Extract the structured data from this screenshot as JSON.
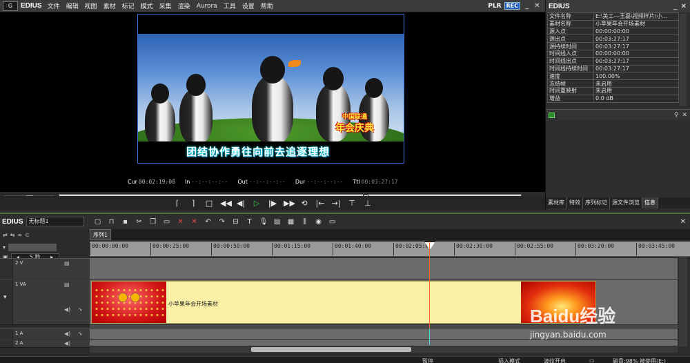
{
  "app_name": "EDIUS",
  "menu": [
    "文件",
    "编辑",
    "视图",
    "素材",
    "标记",
    "模式",
    "采集",
    "渲染",
    "Aurora",
    "工具",
    "设置",
    "帮助"
  ],
  "player_mode": {
    "plr": "PLR",
    "rec": "REC"
  },
  "preview": {
    "subtitle": "团结协作勇往向前去追逐理想",
    "overlay_line1": "中国联通",
    "overlay_line2": "年会庆典"
  },
  "timecodes": [
    {
      "label": "Cur",
      "value": "00:02:19:08"
    },
    {
      "label": "In",
      "value": "--:--:--:--"
    },
    {
      "label": "Out",
      "value": "--:--:--:--"
    },
    {
      "label": "Dur",
      "value": "--:--:--:--"
    },
    {
      "label": "Ttl",
      "value": "00:03:27:17"
    }
  ],
  "scrub_position": 0.665,
  "info_panel": {
    "title": "EDIUS",
    "rows": [
      {
        "key": "文件名称",
        "value": "E:\\美工---王磊\\视频样片\\小..."
      },
      {
        "key": "素材名称",
        "value": "小苹果年会开场素材"
      },
      {
        "key": "源入点",
        "value": "00:00:00:00"
      },
      {
        "key": "源出点",
        "value": "00:03:27:17"
      },
      {
        "key": "源持续时间",
        "value": "00:03:27:17"
      },
      {
        "key": "时间线入点",
        "value": "00:00:00:00"
      },
      {
        "key": "时间线出点",
        "value": "00:03:27:17"
      },
      {
        "key": "时间线持续时间",
        "value": "00:03:27:17"
      },
      {
        "key": "速度",
        "value": "100.00%"
      },
      {
        "key": "冻结帧",
        "value": "未启用"
      },
      {
        "key": "时间重映射",
        "value": "未启用"
      },
      {
        "key": "增益",
        "value": "0.0 dB"
      }
    ],
    "tabs": [
      "素材库",
      "特效",
      "序列标记",
      "源文件浏览",
      "信息"
    ],
    "active_tab": "信息"
  },
  "timeline": {
    "app_name": "EDIUS",
    "project_name": "无标题1",
    "scale_label": "5 秒",
    "sequence_tab": "序列1",
    "ruler_ticks": [
      "00:00:00:00",
      "00:00:25:00",
      "00:00:50:00",
      "00:01:15:00",
      "00:01:40:00",
      "00:02:05:00",
      "00:02:30:00",
      "00:02:55:00",
      "00:03:20:00",
      "00:03:45:00"
    ],
    "tracks": [
      {
        "name": "2 V"
      },
      {
        "name": "1 VA"
      },
      {
        "name": "1 A"
      },
      {
        "name": "2 A"
      }
    ],
    "clip_label": "小苹果年会开场素材"
  },
  "status_bar": {
    "state": "暂停",
    "insert_mode": "插入模式",
    "ripple": "波纹开启",
    "disk": "磁盘:98% 被使用(E:)"
  },
  "watermark": {
    "brand": "Baidu经验",
    "url": "jingyan.baidu.com"
  },
  "colors": {
    "accent_green": "#39d13c",
    "clip_fill": "#fbf1a6",
    "playhead": "#ff6b2d",
    "rec": "#1f5fbf"
  }
}
